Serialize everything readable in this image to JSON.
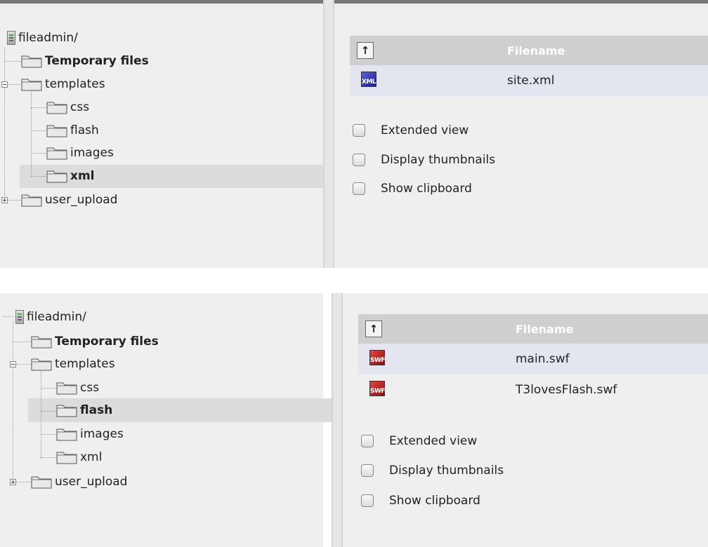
{
  "screens": [
    {
      "tree": {
        "root": "fileadmin/",
        "nodes": [
          {
            "label": "Temporary files"
          },
          {
            "label": "templates"
          },
          {
            "label": "css"
          },
          {
            "label": "flash"
          },
          {
            "label": "images"
          },
          {
            "label": "xml"
          },
          {
            "label": "user_upload"
          }
        ],
        "selected": "xml"
      },
      "files": {
        "up_icon": "folder-up-icon",
        "header": "Filename",
        "rows": [
          {
            "icon": "xml-file-icon",
            "icon_text": "XML",
            "name": "site.xml"
          }
        ]
      },
      "options": [
        "Extended view",
        "Display thumbnails",
        "Show clipboard"
      ]
    },
    {
      "tree": {
        "root": "fileadmin/",
        "nodes": [
          {
            "label": "Temporary files"
          },
          {
            "label": "templates"
          },
          {
            "label": "css"
          },
          {
            "label": "flash"
          },
          {
            "label": "images"
          },
          {
            "label": "xml"
          },
          {
            "label": "user_upload"
          }
        ],
        "selected": "flash"
      },
      "files": {
        "up_icon": "folder-up-icon",
        "header": "Filename",
        "rows": [
          {
            "icon": "swf-file-icon",
            "icon_text": "SWF",
            "name": "main.swf"
          },
          {
            "icon": "swf-file-icon",
            "icon_text": "SWF",
            "name": "T3lovesFlash.swf"
          }
        ]
      },
      "options": [
        "Extended view",
        "Display thumbnails",
        "Show clipboard"
      ]
    }
  ],
  "colors": {
    "selection": "#dcdcdc",
    "header_bg": "#cfcfcf",
    "row_highlight": "#e3e6ee"
  }
}
